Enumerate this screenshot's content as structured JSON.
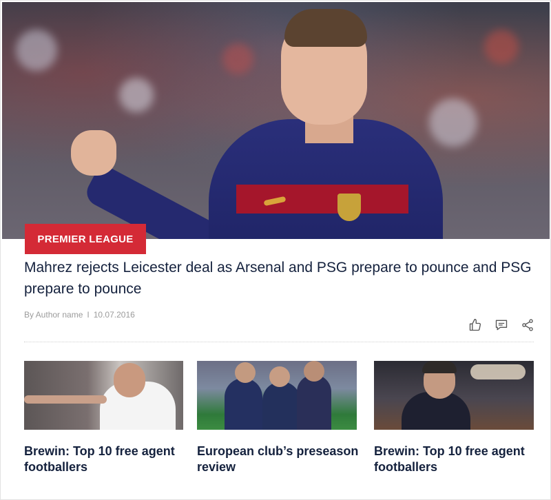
{
  "hero": {
    "category_label": "PREMIER LEAGUE",
    "headline": "Mahrez rejects Leicester deal as Arsenal and PSG prepare to pounce and PSG prepare to pounce",
    "author": "By Author name",
    "separator": "I",
    "date": "10.07.2016",
    "actions": [
      {
        "icon": "thumbs-up-icon"
      },
      {
        "icon": "comment-icon"
      },
      {
        "icon": "share-icon"
      }
    ]
  },
  "stories": [
    {
      "title": "Brewin: Top 10 free agent footballers"
    },
    {
      "title": "European club’s preseason review"
    },
    {
      "title": "Brewin: Top 10 free agent footballers"
    }
  ],
  "colors": {
    "accent": "#d42a36",
    "headline": "#14213d",
    "meta": "#9b9b9b"
  }
}
